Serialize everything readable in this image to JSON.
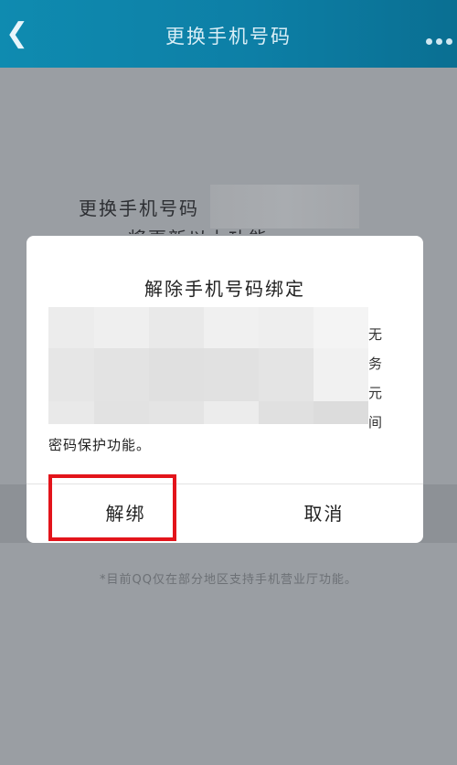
{
  "header": {
    "back_icon": "chevron-left-icon",
    "title": "更换手机号码",
    "more_icon": "more-dots-icon"
  },
  "background_page": {
    "text_line1": "更换手机号码",
    "text_line2": "将更新以上功能",
    "footnote": "*目前QQ仅在部分地区支持手机营业厅功能。"
  },
  "dialog": {
    "title": "解除手机号码绑定",
    "side_chars": [
      "无",
      "务",
      "元",
      "间"
    ],
    "body_tail": "密码保护功能。",
    "buttons": {
      "unbind_label": "解绑",
      "cancel_label": "取消"
    }
  },
  "colors": {
    "header_start": "#0f8bb0",
    "header_end": "#0a6f92",
    "highlight": "#e3141b"
  }
}
